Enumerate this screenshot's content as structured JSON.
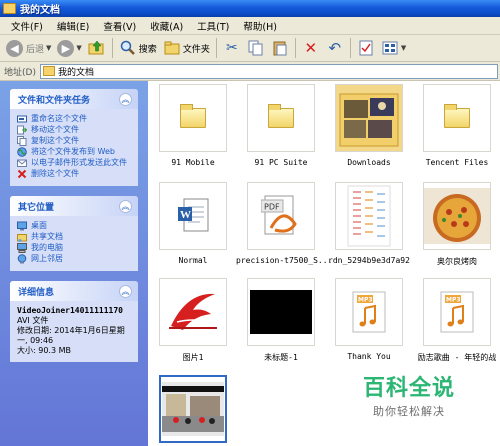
{
  "window": {
    "title": "我的文档"
  },
  "menu": [
    "文件(F)",
    "编辑(E)",
    "查看(V)",
    "收藏(A)",
    "工具(T)",
    "帮助(H)"
  ],
  "toolbar": {
    "back": "后退",
    "search": "搜索",
    "folders": "文件夹"
  },
  "address": {
    "label": "地址(D)",
    "value": "我的文档"
  },
  "tasks": {
    "title": "文件和文件夹任务",
    "items": [
      "重命名这个文件",
      "移动这个文件",
      "复制这个文件",
      "将这个文件发布到 Web",
      "以电子邮件形式发送此文件",
      "删除这个文件"
    ]
  },
  "places": {
    "title": "其它位置",
    "items": [
      "桌面",
      "共享文档",
      "我的电脑",
      "网上邻居"
    ]
  },
  "details": {
    "title": "详细信息",
    "name": "VideoJoiner14011111170",
    "type": "AVI 文件",
    "modified": "修改日期: 2014年1月6日星期一, 09:46",
    "size": "大小: 90.3 MB"
  },
  "files": [
    {
      "label": "91 Mobile",
      "kind": "folder"
    },
    {
      "label": "91 PC Suite",
      "kind": "folder"
    },
    {
      "label": "Downloads",
      "kind": "folder-photos"
    },
    {
      "label": "Tencent Files",
      "kind": "folder"
    },
    {
      "label": "Normal",
      "kind": "word"
    },
    {
      "label": "precision-t7500_S...",
      "kind": "pdf"
    },
    {
      "label": "rdn_5294b9e3d7a92",
      "kind": "spreadsheet"
    },
    {
      "label": "奥尔良烤肉",
      "kind": "pizza"
    },
    {
      "label": "图片1",
      "kind": "logo"
    },
    {
      "label": "未标题-1",
      "kind": "black"
    },
    {
      "label": "Thank You",
      "kind": "mp3"
    },
    {
      "label": "励志歌曲 - 年轻的战",
      "kind": "mp3"
    },
    {
      "label": "",
      "kind": "video"
    }
  ],
  "watermark": {
    "title": "百科全说",
    "subtitle": "助你轻松解决"
  },
  "colors": {
    "titlebar": "#0b4dc8",
    "taskpane": "#6375d6",
    "link": "#215dc6",
    "watermark": "#2bb673"
  }
}
